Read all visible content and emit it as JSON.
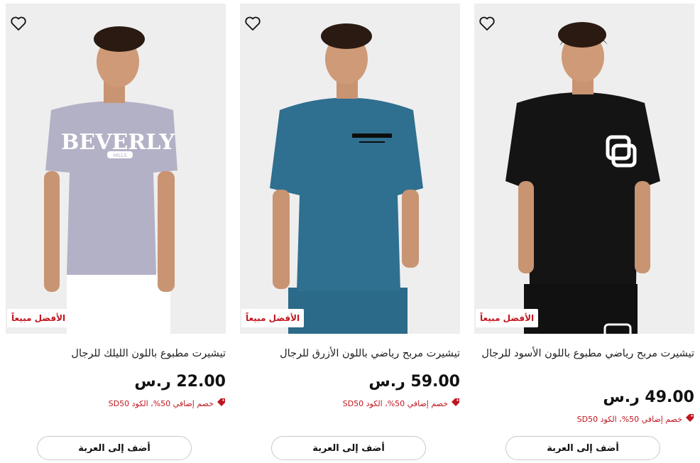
{
  "products": [
    {
      "title": "تيشيرت مربح رياضي مطبوع باللون الأسود للرجال",
      "price": "49.00 ر.س",
      "promo": "خصم إضافي 50%، الكود SD50",
      "badge": "الأفضل مبيعاً",
      "cta": "أضف إلى العربة",
      "shirt_color": "#141414"
    },
    {
      "title": "تيشيرت مربح رياضي باللون الأزرق للرجال",
      "price": "59.00 ر.س",
      "promo": "خصم إضافي 50%، الكود SD50",
      "badge": "الأفضل مبيعاً",
      "cta": "أضف إلى العربة",
      "shirt_color": "#2f6f8f"
    },
    {
      "title": "تيشيرت مطبوع باللون الليلك للرجال",
      "price": "22.00 ر.س",
      "promo": "خصم إضافي 50%، الكود SD50",
      "badge": "الأفضل مبيعاً",
      "cta": "أضف إلى العربة",
      "shirt_color": "#b3b1c6",
      "print_text": "BEVERLY",
      "print_subtext": "HILLS"
    }
  ],
  "colors": {
    "accent_red": "#c0161f",
    "image_bg": "#eeeeee"
  },
  "icons": {
    "wishlist": "heart-outline-icon",
    "promo": "tag-icon"
  }
}
